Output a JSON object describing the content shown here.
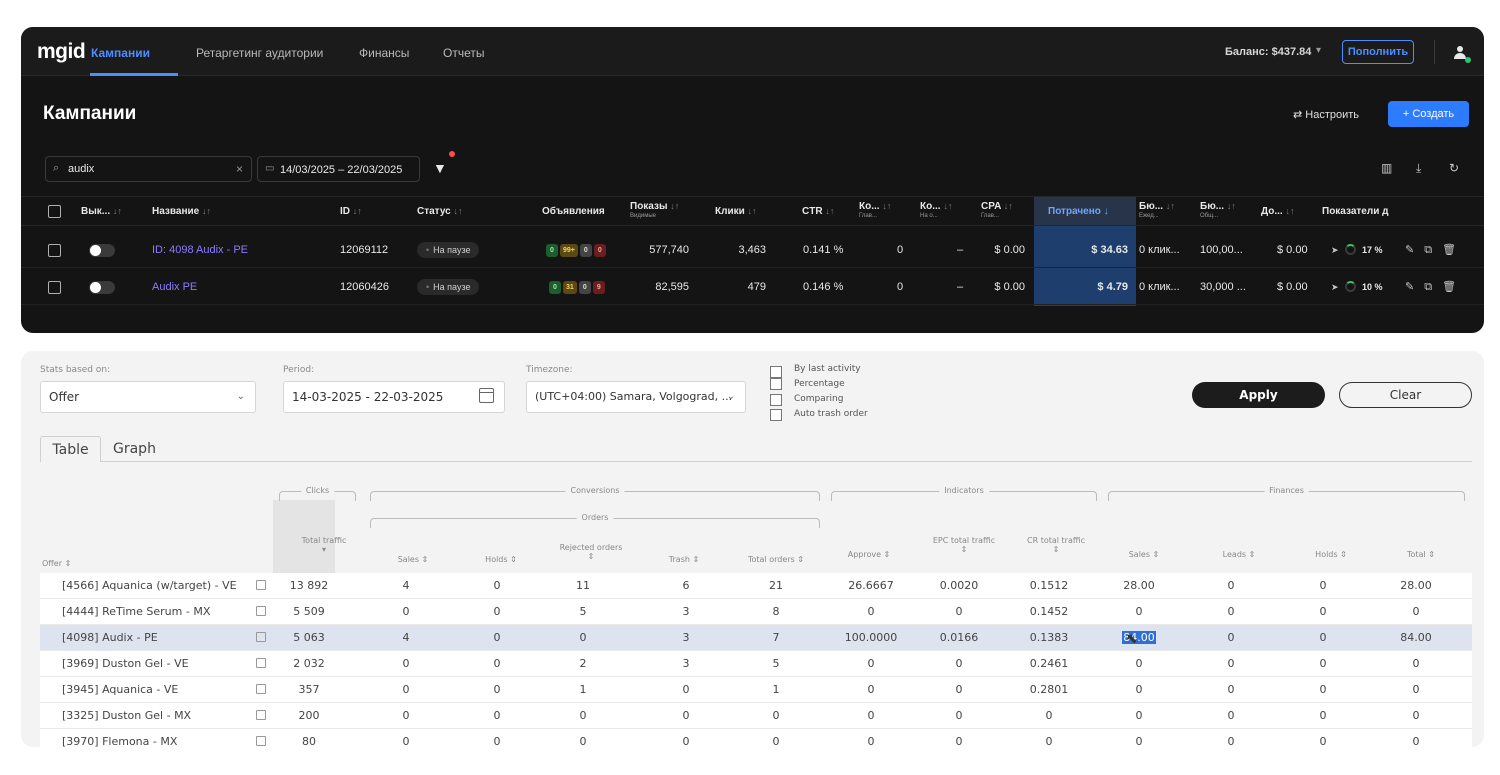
{
  "nav": {
    "logo": "mgid",
    "items": [
      "Кампании",
      "Ретаргетинг аудитории",
      "Финансы",
      "Отчеты"
    ],
    "balance": "Баланс: $437.84",
    "topup": "Пополнить"
  },
  "campaigns": {
    "title": "Кампании",
    "configure": "⇄ Настроить",
    "create": "+ Создать",
    "search_value": "audix",
    "date_range": "14/03/2025 – 22/03/2025",
    "headers": {
      "enabled": "Вык...",
      "name": "Название",
      "id": "ID",
      "status": "Статус",
      "ads": "Объявления",
      "impressions": "Показы",
      "impressions_sub": "Видимые",
      "clicks": "Клики",
      "ctr": "CTR",
      "conv1": "Ко...",
      "conv1_sub": "Глав...",
      "conv2": "Ко...",
      "conv2_sub": "На о...",
      "cpa": "CPA",
      "cpa_sub": "Глав...",
      "spent": "Потрачено ↓",
      "budget1": "Бю...",
      "budget1_sub": "Ежед...",
      "budget2": "Бю...",
      "budget2_sub": "Общ...",
      "income": "До...",
      "indicators": "Показатели д"
    },
    "rows": [
      {
        "name": "ID: 4098 Audix - PE",
        "id": "12069112",
        "status": "На паузе",
        "ads": [
          "0",
          "99+",
          "0",
          "0"
        ],
        "impressions": "577,740",
        "clicks": "3,463",
        "ctr": "0.141 %",
        "conv1": "0",
        "conv2": "–",
        "cpa": "$ 0.00",
        "spent": "$ 34.63",
        "budget_daily": "0 клик...",
        "budget_total": "100,00...",
        "income": "$ 0.00",
        "indicator": "17 %"
      },
      {
        "name": "Audix PE",
        "id": "12060426",
        "status": "На паузе",
        "ads": [
          "0",
          "31",
          "0",
          "9"
        ],
        "impressions": "82,595",
        "clicks": "479",
        "ctr": "0.146 %",
        "conv1": "0",
        "conv2": "–",
        "cpa": "$ 0.00",
        "spent": "$ 4.79",
        "budget_daily": "0 клик...",
        "budget_total": "30,000 ...",
        "income": "$ 0.00",
        "indicator": "10 %"
      }
    ]
  },
  "stats": {
    "stats_label": "Stats based on:",
    "stats_value": "Offer",
    "period_label": "Period:",
    "period_value": "14-03-2025 - 22-03-2025",
    "timezone_label": "Timezone:",
    "timezone_value": "(UTC+04:00) Samara, Volgograd, ...",
    "options": [
      "By last activity",
      "Percentage",
      "Comparing",
      "Auto trash order"
    ],
    "apply": "Apply",
    "clear": "Clear",
    "tabs": [
      "Table",
      "Graph"
    ],
    "groups": {
      "clicks": "Clicks",
      "conversions": "Conversions",
      "orders": "Orders",
      "indicators": "Indicators",
      "finances": "Finances"
    },
    "columns": {
      "offer": "Offer",
      "total_traffic": "Total traffic",
      "sales": "Sales",
      "holds": "Holds",
      "rejected": "Rejected orders",
      "trash": "Trash",
      "total_orders": "Total orders",
      "approve": "Approve",
      "epc": "EPC total traffic",
      "cr": "CR total traffic",
      "f_sales": "Sales",
      "f_leads": "Leads",
      "f_holds": "Holds",
      "f_total": "Total"
    },
    "rows": [
      {
        "offer": "[4566] Aquanica (w/target) - VE",
        "traffic": "13 892",
        "sales": "4",
        "holds": "0",
        "rejected": "11",
        "trash": "6",
        "total": "21",
        "approve": "26.6667",
        "epc": "0.0020",
        "cr": "0.1512",
        "f_sales": "28.00",
        "f_leads": "0",
        "f_holds": "0",
        "f_total": "28.00"
      },
      {
        "offer": "[4444] ReTime Serum - MX",
        "traffic": "5 509",
        "sales": "0",
        "holds": "0",
        "rejected": "5",
        "trash": "3",
        "total": "8",
        "approve": "0",
        "epc": "0",
        "cr": "0.1452",
        "f_sales": "0",
        "f_leads": "0",
        "f_holds": "0",
        "f_total": "0"
      },
      {
        "offer": "[4098] Audix - PE",
        "traffic": "5 063",
        "sales": "4",
        "holds": "0",
        "rejected": "0",
        "trash": "3",
        "total": "7",
        "approve": "100.0000",
        "epc": "0.0166",
        "cr": "0.1383",
        "f_sales": "84.00",
        "f_leads": "0",
        "f_holds": "0",
        "f_total": "84.00"
      },
      {
        "offer": "[3969] Duston Gel - VE",
        "traffic": "2 032",
        "sales": "0",
        "holds": "0",
        "rejected": "2",
        "trash": "3",
        "total": "5",
        "approve": "0",
        "epc": "0",
        "cr": "0.2461",
        "f_sales": "0",
        "f_leads": "0",
        "f_holds": "0",
        "f_total": "0"
      },
      {
        "offer": "[3945] Aquanica - VE",
        "traffic": "357",
        "sales": "0",
        "holds": "0",
        "rejected": "1",
        "trash": "0",
        "total": "1",
        "approve": "0",
        "epc": "0",
        "cr": "0.2801",
        "f_sales": "0",
        "f_leads": "0",
        "f_holds": "0",
        "f_total": "0"
      },
      {
        "offer": "[3325] Duston Gel - MX",
        "traffic": "200",
        "sales": "0",
        "holds": "0",
        "rejected": "0",
        "trash": "0",
        "total": "0",
        "approve": "0",
        "epc": "0",
        "cr": "0",
        "f_sales": "0",
        "f_leads": "0",
        "f_holds": "0",
        "f_total": "0"
      },
      {
        "offer": "[3970] Flemona - MX",
        "traffic": "80",
        "sales": "0",
        "holds": "0",
        "rejected": "0",
        "trash": "0",
        "total": "0",
        "approve": "0",
        "epc": "0",
        "cr": "0",
        "f_sales": "0",
        "f_leads": "0",
        "f_holds": "0",
        "f_total": "0"
      }
    ]
  }
}
